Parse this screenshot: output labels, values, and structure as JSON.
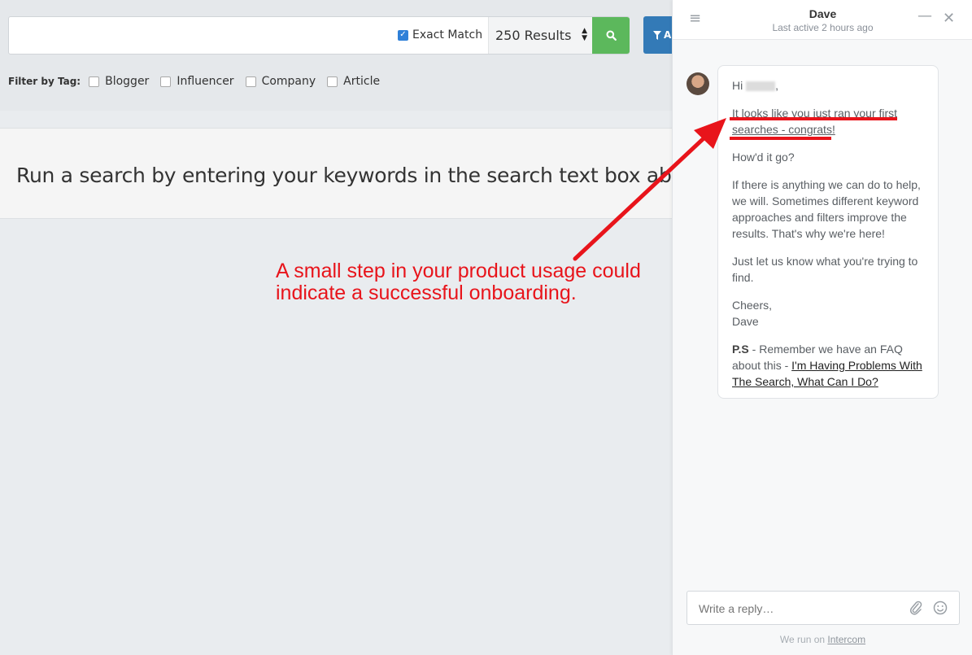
{
  "search": {
    "value": "",
    "exact_match_label": "Exact Match",
    "results_label": "250 Results",
    "advanced_label": "A"
  },
  "filters": {
    "label": "Filter by Tag:",
    "tags": [
      "Blogger",
      "Influencer",
      "Company",
      "Article"
    ]
  },
  "empty_state": {
    "text": "Run a search by entering your keywords in the search text box above"
  },
  "annotation": {
    "line1": "A small step in your product usage could",
    "line2": "indicate a successful onboarding.",
    "color": "#e8141b"
  },
  "chat": {
    "agent_name": "Dave",
    "status": "Last active 2 hours ago",
    "message": {
      "greeting": "Hi",
      "greeting_suffix": ",",
      "highlight": "It looks like you just ran your first searches - congrats!",
      "p2": "How'd it go?",
      "p3": "If there is anything we can do to help, we will. Sometimes different keyword approaches and filters improve the results. That's why we're here!",
      "p4": "Just let us know what you're trying to find.",
      "signoff": "Cheers,",
      "signature": "Dave",
      "ps_label": "P.S",
      "ps_text": " - Remember we have an FAQ about this - ",
      "ps_link": "I'm Having Problems With The Search, What Can I Do?"
    },
    "reply_placeholder": "Write a reply…",
    "powered_prefix": "We run on ",
    "powered_brand": "Intercom"
  },
  "colors": {
    "search_button": "#5cb85c",
    "advanced_button": "#337ab7",
    "annotation_red": "#e8141b"
  }
}
